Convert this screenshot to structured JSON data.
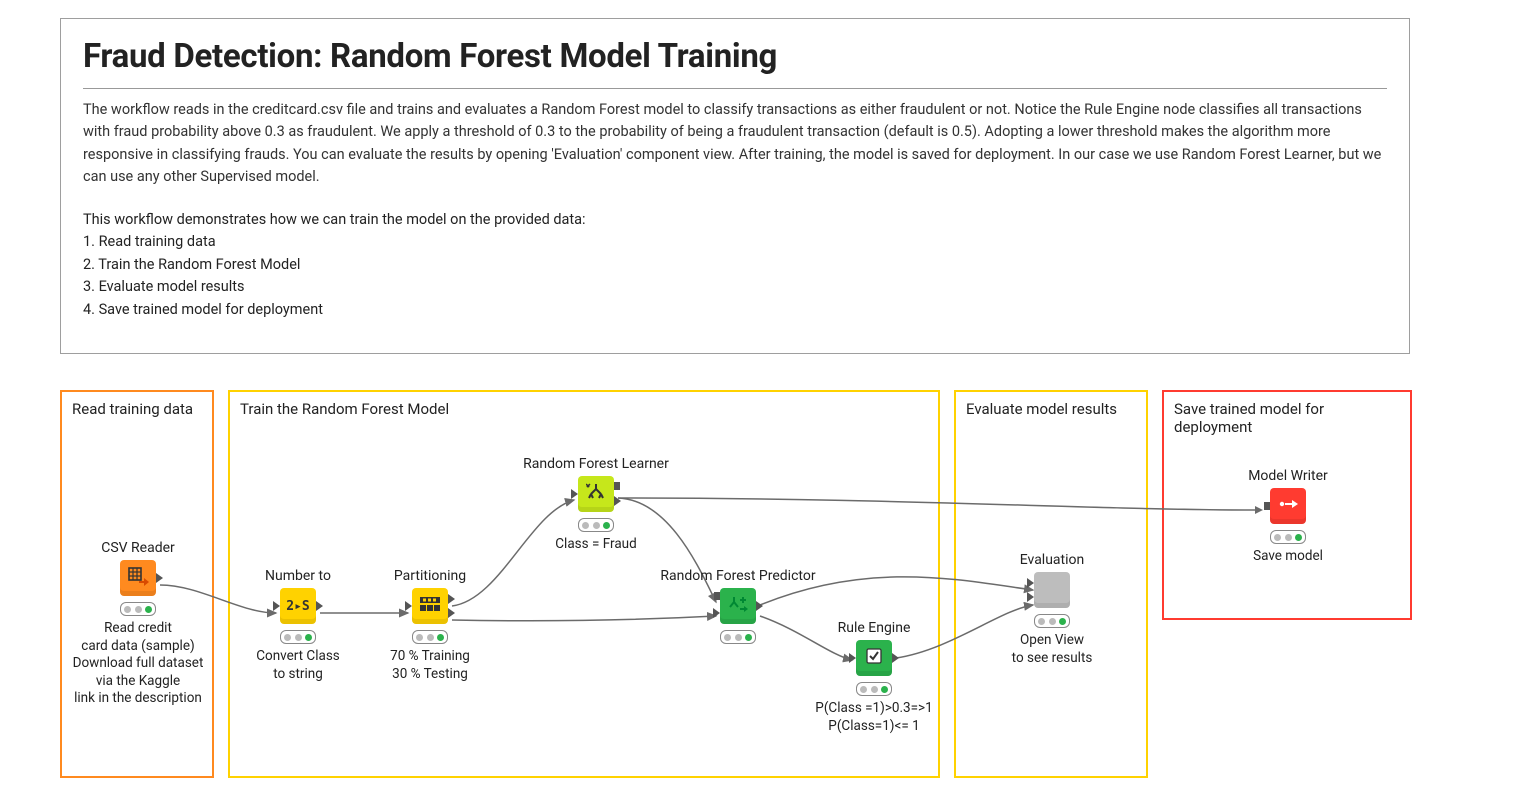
{
  "header": {
    "title": "Fraud Detection: Random Forest Model Training",
    "description": "The workflow reads in the creditcard.csv file and trains and evaluates a Random Forest model to classify transactions as either fraudulent or not. Notice the Rule Engine node classifies all transactions with fraud probability above 0.3 as fraudulent. We apply a threshold of 0.3 to the probability of being a fraudulent transaction (default is 0.5). Adopting a lower threshold makes the algorithm more responsive in classifying frauds. You can evaluate the results by opening 'Evaluation' component view. After training, the model is saved for deployment. In our case we use Random Forest Learner, but we can use any other Supervised model.",
    "steps_intro": "This workflow demonstrates how we can train the model on the provided data:",
    "steps": [
      "1. Read training data",
      "2. Train the Random Forest Model",
      "3. Evaluate model results",
      "4. Save trained model for deployment"
    ]
  },
  "zones": {
    "read": {
      "title": "Read training data",
      "color": "#ff8a1f"
    },
    "train": {
      "title": "Train the Random Forest Model",
      "color": "#ffd200"
    },
    "eval": {
      "title": "Evaluate model results",
      "color": "#ffd200"
    },
    "save": {
      "title": "Save trained model for\ndeployment",
      "color": "#ff3b30"
    }
  },
  "nodes": {
    "csv": {
      "title": "CSV Reader",
      "caption": "Read credit\ncard data (sample)\nDownload full dataset\nvia the Kaggle\nlink in the description",
      "color": "#ff8a1f",
      "glyph": "table-arrow"
    },
    "num2str": {
      "title": "Number to",
      "caption": "Convert Class\nto string",
      "color": "#ffd200",
      "glyph": "2s"
    },
    "partition": {
      "title": "Partitioning",
      "caption": "70 % Training\n30 % Testing",
      "color": "#ffd200",
      "glyph": "grid"
    },
    "learner": {
      "title": "Random Forest Learner",
      "caption": "Class = Fraud",
      "color": "#c6e71b",
      "glyph": "tree"
    },
    "predictor": {
      "title": "Random Forest Predictor",
      "caption": "",
      "color": "#2bb24c",
      "glyph": "tree-swap"
    },
    "rule": {
      "title": "Rule Engine",
      "caption": "P(Class =1)>0.3=>1\nP(Class=1)<= 1",
      "color": "#2bb24c",
      "glyph": "check"
    },
    "evaluation": {
      "title": "Evaluation",
      "caption": "Open View\nto see results",
      "color": "#bdbdbd",
      "glyph": ""
    },
    "writer": {
      "title": "Model Writer",
      "caption": "Save model",
      "color": "#ff3b30",
      "glyph": "arrow-dot"
    }
  }
}
